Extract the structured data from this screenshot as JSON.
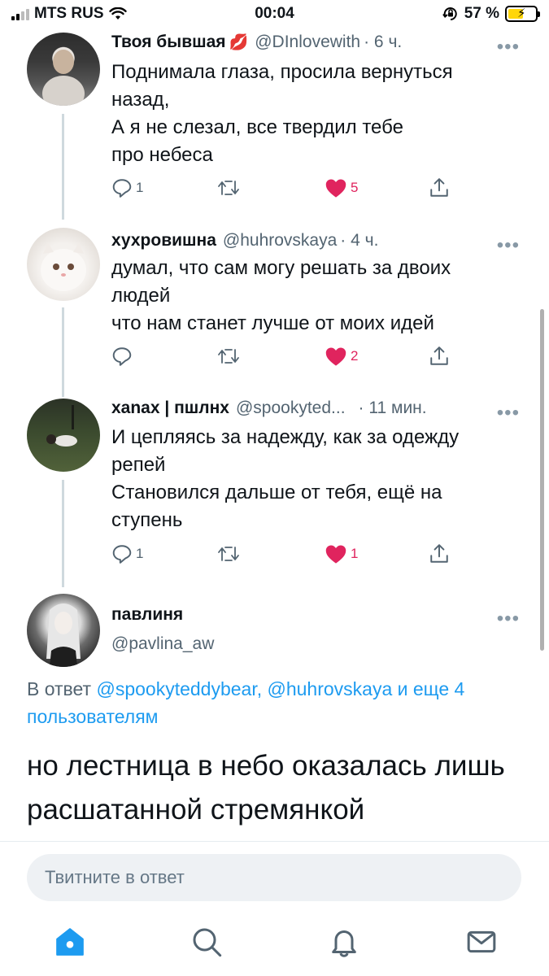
{
  "status_bar": {
    "carrier": "MTS RUS",
    "time": "00:04",
    "battery_percent": "57 %",
    "battery_level": 0.57,
    "icons": [
      "signal-icon",
      "wifi-icon",
      "orientation-lock-icon",
      "battery-charging-icon"
    ]
  },
  "tweets": [
    {
      "name": "Твоя бывшая",
      "name_emoji": "💋",
      "handle": "@DInlovewith",
      "time": "· 6 ч.",
      "text": "Поднимала глаза, просила вернуться\nназад,\nА я не слезал, все твердил тебе\nпро небеса",
      "replies": "1",
      "retweets": "",
      "likes": "5",
      "liked": true
    },
    {
      "name": "хухровишна",
      "handle": "@huhrovskaya",
      "time": "· 4 ч.",
      "text": "думал, что сам могу решать за двоих\nлюдей\nчто нам станет лучше от моих идей",
      "replies": "",
      "retweets": "",
      "likes": "2",
      "liked": true
    },
    {
      "name": "xanax | пшлнх",
      "handle": "@spookyted...",
      "time": "· 11 мин.",
      "text": "И цепляясь за надежду, как за одежду\nрепей\nСтановился дальше от тебя, ещё на\nступень",
      "replies": "1",
      "retweets": "",
      "likes": "1",
      "liked": true
    }
  ],
  "focused_tweet": {
    "name": "павлиня",
    "handle": "@pavlina_aw",
    "reply_prefix": "В ответ",
    "reply_mentions": "@spookyteddybear, @huhrovskaya и еще 4 пользователям",
    "text": "но лестница в небо оказалась лишь расшатанной стремянкой"
  },
  "reply_box": {
    "placeholder": "Твитните в ответ"
  },
  "tab_bar": {
    "items": [
      "home-icon",
      "search-icon",
      "notifications-icon",
      "messages-icon"
    ],
    "active": "home-icon"
  },
  "colors": {
    "accent": "#1d9bf0",
    "like": "#e0245e",
    "secondary_text": "#536471"
  }
}
